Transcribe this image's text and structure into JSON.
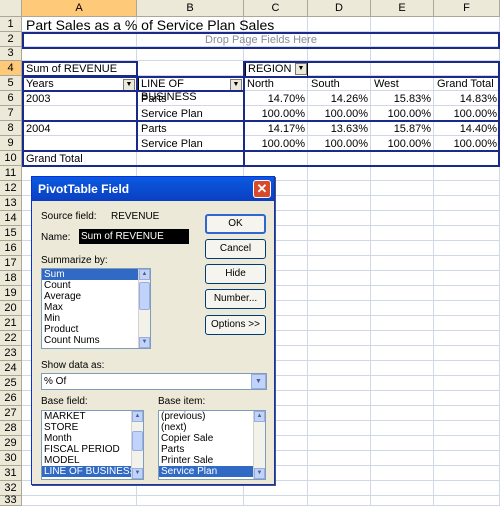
{
  "sheet": {
    "columns": [
      "A",
      "B",
      "C",
      "D",
      "E",
      "F"
    ],
    "rows": [
      "1",
      "2",
      "3",
      "4",
      "5",
      "6",
      "7",
      "8",
      "9",
      "10",
      "11",
      "12",
      "13",
      "14",
      "15",
      "16",
      "17",
      "18",
      "19",
      "20",
      "21",
      "22",
      "23",
      "24",
      "25",
      "26",
      "27",
      "28",
      "29",
      "30",
      "31",
      "32",
      "33"
    ],
    "title": "Part Sales as a % of Service Plan Sales",
    "page_drop_zone": "Drop Page Fields Here",
    "data_field": "Sum of REVENUE",
    "column_field": "REGION",
    "row_field_1": "Years",
    "row_field_2": "LINE OF BUSINESS",
    "column_items": [
      "North",
      "South",
      "West",
      "Grand Total"
    ],
    "table": [
      {
        "year": "2003",
        "line": "Parts",
        "values": [
          "14.70%",
          "14.26%",
          "15.83%",
          "14.83%"
        ]
      },
      {
        "year": "",
        "line": "Service Plan",
        "values": [
          "100.00%",
          "100.00%",
          "100.00%",
          "100.00%"
        ]
      },
      {
        "year": "2004",
        "line": "Parts",
        "values": [
          "14.17%",
          "13.63%",
          "15.87%",
          "14.40%"
        ]
      },
      {
        "year": "",
        "line": "Service Plan",
        "values": [
          "100.00%",
          "100.00%",
          "100.00%",
          "100.00%"
        ]
      }
    ],
    "grand_total_label": "Grand Total",
    "colors": {
      "pivot_border": "#1a2a8a",
      "header_bg": "#ece9d8",
      "selected_header": "#ffc97a"
    }
  },
  "dialog": {
    "title": "PivotTable Field",
    "source_field_label": "Source field:",
    "source_field_value": "REVENUE",
    "name_label": "Name:",
    "name_value": "Sum of REVENUE",
    "summarize_label": "Summarize by:",
    "summarize_items": [
      "Sum",
      "Count",
      "Average",
      "Max",
      "Min",
      "Product",
      "Count Nums"
    ],
    "summarize_selected": "Sum",
    "buttons": {
      "ok": "OK",
      "cancel": "Cancel",
      "hide": "Hide",
      "number": "Number...",
      "options": "Options >>"
    },
    "show_data_label": "Show data as:",
    "show_data_value": "% Of",
    "base_field_label": "Base field:",
    "base_field_items": [
      "MARKET",
      "STORE",
      "Month",
      "FISCAL PERIOD",
      "MODEL",
      "LINE OF BUSINESS"
    ],
    "base_field_selected": "LINE OF BUSINESS",
    "base_item_label": "Base item:",
    "base_item_items": [
      "(previous)",
      "(next)",
      "Copier Sale",
      "Parts",
      "Printer Sale",
      "Service Plan"
    ],
    "base_item_selected": "Service Plan",
    "close_icon": "close-icon",
    "title_color": "#0b4fd8"
  }
}
